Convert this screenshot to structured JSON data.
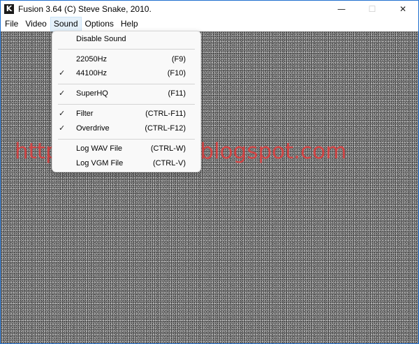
{
  "window": {
    "title": "Fusion 3.64 (C) Steve Snake, 2010.",
    "app_icon_letter": "K",
    "controls": {
      "minimize": "—",
      "maximize": "☐",
      "close": "✕"
    }
  },
  "menubar": {
    "items": [
      "File",
      "Video",
      "Sound",
      "Options",
      "Help"
    ],
    "active": "Sound"
  },
  "sound_menu": {
    "items": [
      {
        "label": "Disable Sound",
        "shortcut": "",
        "checked": ""
      },
      {
        "label": "22050Hz",
        "shortcut": "(F9)",
        "checked": ""
      },
      {
        "label": "44100Hz",
        "shortcut": "(F10)",
        "checked": "✓"
      },
      {
        "label": "SuperHQ",
        "shortcut": "(F11)",
        "checked": "✓"
      },
      {
        "label": "Filter",
        "shortcut": "(CTRL-F11)",
        "checked": "✓"
      },
      {
        "label": "Overdrive",
        "shortcut": "(CTRL-F12)",
        "checked": "✓"
      },
      {
        "label": "Log WAV File",
        "shortcut": "(CTRL-W)",
        "checked": ""
      },
      {
        "label": "Log VGM File",
        "shortcut": "(CTRL-V)",
        "checked": ""
      }
    ]
  },
  "watermark": "https://codeflare.blogspot.com",
  "colors": {
    "accent_border": "#1f6fcf",
    "watermark": "#e13c3c",
    "menu_active": "#e5f1fb"
  }
}
